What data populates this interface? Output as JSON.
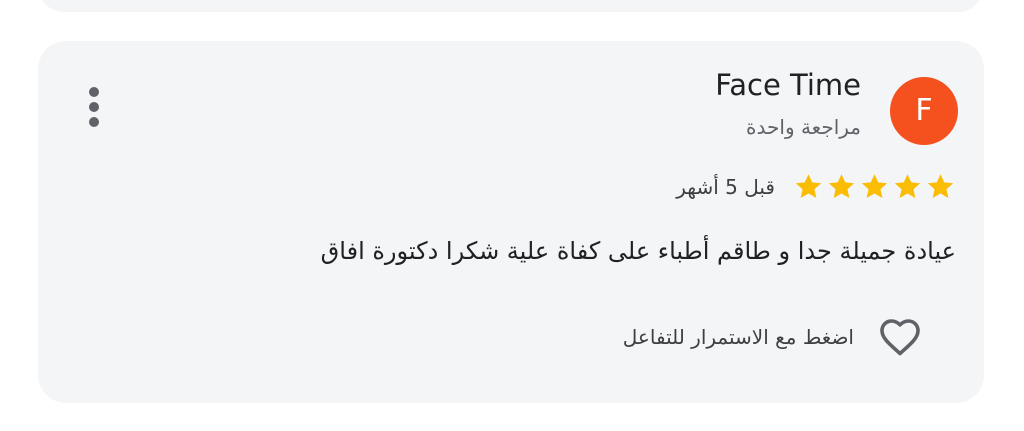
{
  "review": {
    "author_name": "Face Time",
    "avatar_letter": "F",
    "avatar_color": "#f4511e",
    "review_count": "مراجعة واحدة",
    "rating": 5,
    "max_rating": 5,
    "star_color": "#fbbc04",
    "time_ago": "قبل 5 أشهر",
    "text": "عيادة جميلة جدا و طاقم أطباء على كفاة علية شكرا دكتورة افاق",
    "react_label": "اضغط مع الاستمرار للتفاعل",
    "more_icon": "more-vert-icon",
    "react_icon": "heart-outline-icon"
  }
}
